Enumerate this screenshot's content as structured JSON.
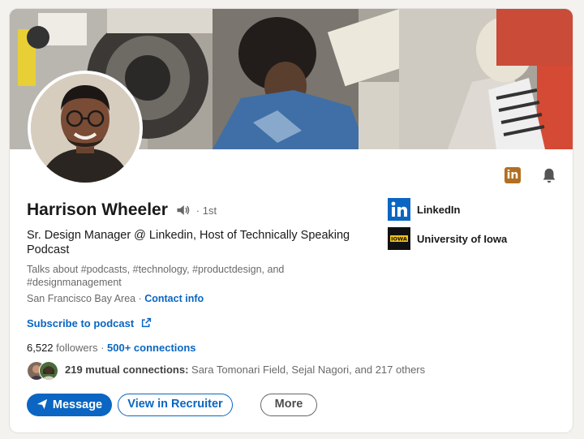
{
  "profile": {
    "name": "Harrison Wheeler",
    "degree": "· 1st",
    "headline": "Sr. Design Manager @ Linkedin, Host of Technically Speaking Podcast",
    "about": "Talks about #podcasts, #technology, #productdesign, and #designmanagement",
    "location": "San Francisco Bay Area",
    "location_sep": " · ",
    "contact_info": "Contact info",
    "subscribe": "Subscribe to podcast",
    "followers": "6,522",
    "followers_label": " followers",
    "connections_sep": "  · ",
    "connections": "500+ connections",
    "mutual_count": "219 mutual connections:",
    "mutual_names": " Sara Tomonari Field, Sejal Nagori, and 217 others"
  },
  "top_actions": {
    "linkedin_badge": "in",
    "bell_icon": "bell-icon"
  },
  "experience": [
    {
      "name": "LinkedIn",
      "logo": "linkedin-logo"
    },
    {
      "name": "University of Iowa",
      "logo": "iowa-logo",
      "logo_text": "IOWA"
    }
  ],
  "actions": {
    "message": "Message",
    "recruiter": "View in Recruiter",
    "more": "More"
  },
  "colors": {
    "accent": "#0a66c2",
    "premium": "#b26f21",
    "iowa_gold": "#f5c518"
  }
}
